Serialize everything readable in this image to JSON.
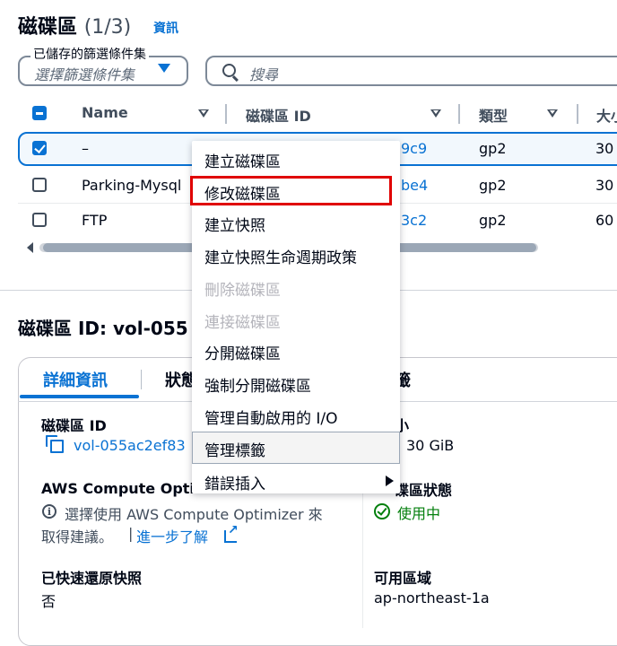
{
  "header": {
    "title": "磁碟區",
    "count": "(1/3)",
    "info_link": "資訊"
  },
  "filters": {
    "saved_filter_label": "已儲存的篩選條件集",
    "saved_filter_placeholder": "選擇篩選條件集",
    "search_placeholder": "搜尋"
  },
  "table": {
    "columns": [
      "Name",
      "磁碟區 ID",
      "類型",
      "大小"
    ],
    "rows": [
      {
        "name": "–",
        "volume_id_suffix": "9c9",
        "type": "gp2",
        "size": "30",
        "selected": true
      },
      {
        "name": "Parking-Mysql",
        "volume_id_suffix": "be4",
        "type": "gp2",
        "size": "30",
        "selected": false
      },
      {
        "name": "FTP",
        "volume_id_suffix": "3c2",
        "type": "gp2",
        "size": "60",
        "selected": false
      }
    ]
  },
  "context_menu": {
    "items": [
      {
        "label": "建立磁碟區",
        "disabled": false
      },
      {
        "label": "修改磁碟區",
        "disabled": false
      },
      {
        "label": "建立快照",
        "disabled": false
      },
      {
        "label": "建立快照生命週期政策",
        "disabled": false
      },
      {
        "label": "刪除磁碟區",
        "disabled": true
      },
      {
        "label": "連接磁碟區",
        "disabled": true
      },
      {
        "label": "分開磁碟區",
        "disabled": false
      },
      {
        "label": "強制分開磁碟區",
        "disabled": false
      },
      {
        "label": "管理自動啟用的 I/O",
        "disabled": false
      },
      {
        "label": "管理標籤",
        "disabled": false
      },
      {
        "label": "錯誤插入",
        "disabled": false
      }
    ],
    "highlighted_item": "修改磁碟區"
  },
  "details": {
    "title": "磁碟區 ID: vol-055",
    "tabs": [
      "詳細資訊",
      "狀態",
      "籤"
    ],
    "volume_id_label": "磁碟區 ID",
    "volume_id_value": "vol-055ac2ef83",
    "size_label": "小",
    "size_value": "30 GiB",
    "optimizer_label": "AWS Compute Opti",
    "optimizer_text_1": "選擇使用 AWS Compute Optimizer 來",
    "optimizer_text_2": "取得建議。",
    "optimizer_pipe": "|",
    "learn_more": "進一步了解",
    "volume_state_label": "碟區狀態",
    "volume_state_value": "使用中",
    "fast_restore_label": "已快速還原快照",
    "fast_restore_value": "否",
    "az_label": "可用區域",
    "az_value": "ap-northeast-1a"
  },
  "colors": {
    "accent": "#0972d3",
    "success": "#037f0c",
    "highlight": "#e00000"
  }
}
